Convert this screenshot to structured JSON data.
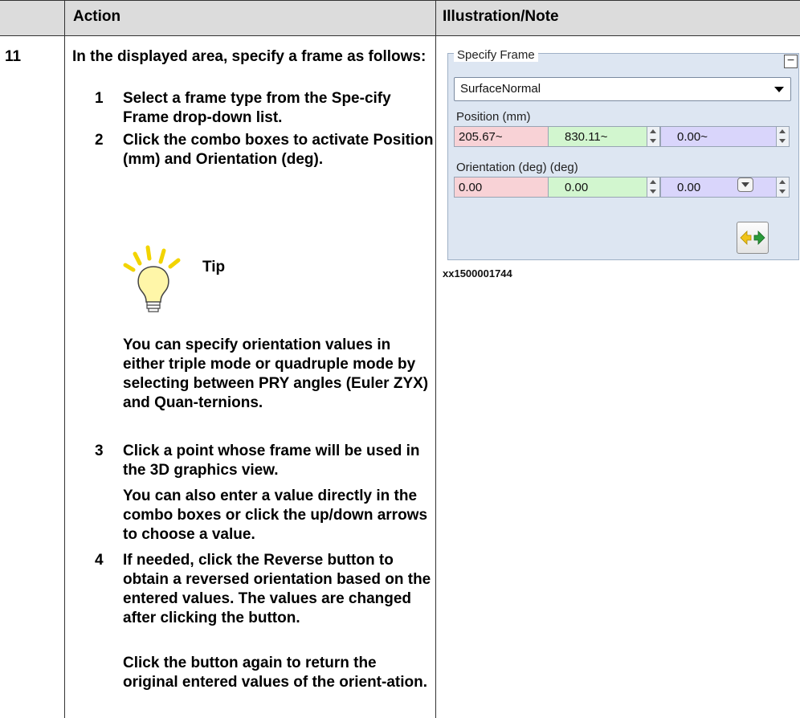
{
  "header": {
    "action": "Action",
    "illustration": "Illustration/Note"
  },
  "step": {
    "number": "11",
    "intro": "In the displayed area, specify a frame as follows:",
    "items": [
      {
        "num": "1",
        "parts": [
          "Select a frame type from the ",
          "Spe-cify Frame",
          " drop-down list."
        ]
      },
      {
        "num": "2",
        "parts": [
          "Click the combo boxes to activate ",
          "Position (mm)",
          " and ",
          "Orientation (deg)",
          "."
        ]
      },
      {
        "num": "3",
        "text": "Click a point whose frame will be used in the 3D graphics view."
      },
      {
        "num": "4",
        "parts": [
          "If needed, click the ",
          "Reverse",
          " button to obtain a reversed orientation based on the entered values. The values are changed after clicking the button."
        ]
      }
    ],
    "item3_note": "You can also enter a value directly in the combo boxes or click the up/down arrows to choose a value.",
    "item4_note": "Click the button again to return the original entered values of the orient-ation."
  },
  "tip": {
    "label": "Tip",
    "body_parts": [
      "You can specify orientation values in either triple mode or quadruple mode by selecting between ",
      "PRY angles (Euler ZYX)",
      " and ",
      "Quan-ternions",
      "."
    ]
  },
  "illustration": {
    "panel_title": "Specify Frame",
    "frame_type": "SurfaceNormal",
    "position_label": "Position (mm)",
    "position": [
      "205.67~",
      "830.11~",
      "0.00~"
    ],
    "orientation_label": "Orientation (deg) (deg)",
    "orientation": [
      "0.00",
      "0.00",
      "0.00"
    ],
    "caption": "xx1500001744"
  },
  "colors": {
    "header_bg": "#dcdcdc",
    "x_field": "#f8d2d6",
    "y_field": "#d2f6cf",
    "z_field": "#d9d5fb",
    "panel_bg": "#dde6f2"
  },
  "icons": [
    "lightbulb-icon",
    "collapse-icon",
    "dropdown-arrow-icon",
    "spin-up-icon",
    "spin-down-icon",
    "chevron-down-icon",
    "reverse-arrows-icon"
  ]
}
